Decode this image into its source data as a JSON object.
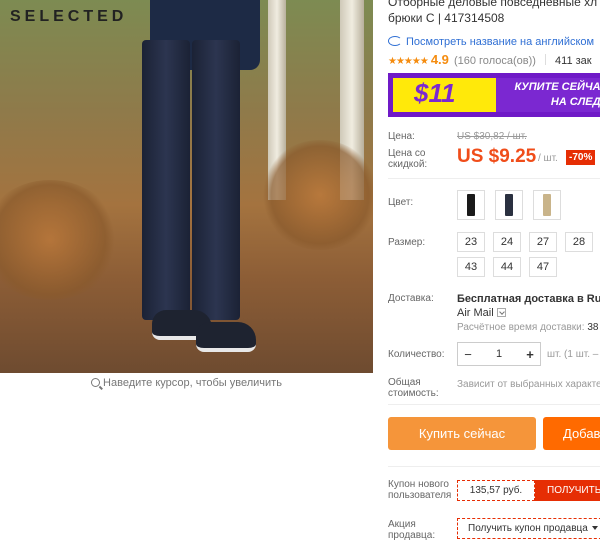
{
  "gallery": {
    "brand": "SELECTED",
    "zoom_hint": "Наведите курсор, чтобы увеличить"
  },
  "product": {
    "title_line1": "Отборные деловые повседневные хл",
    "title_line2": "брюки C | 417314508",
    "translate_link": "Посмотреть название на английском",
    "stars": "★★★★★",
    "rating": "4.9",
    "votes": "(160 голоса(ов))",
    "orders": "411 зак"
  },
  "promo": {
    "amount": "$11",
    "line1": "КУПИТЕ СЕЙЧАС",
    "line2": "НА СЛЕДУ"
  },
  "price": {
    "old_label": "Цена:",
    "old_value": "US $30,82 / шт.",
    "new_label_line1": "Цена со",
    "new_label_line2": "скидкой:",
    "new_value": "US $9.25",
    "unit": "/ шт.",
    "discount": "-70%"
  },
  "options": {
    "color_label": "Цвет:",
    "size_label": "Размер:",
    "sizes": [
      "23",
      "24",
      "27",
      "28",
      "43",
      "44",
      "47"
    ]
  },
  "shipping": {
    "label": "Доставка:",
    "text_line1": "Бесплатная доставка в Russia",
    "text_line2": "Air Mail",
    "time_label": "Расчётное время доставки:",
    "time_value": "38"
  },
  "quantity": {
    "label": "Количество:",
    "minus": "−",
    "value": "1",
    "plus": "+",
    "unit": "шт. (1 шт. – не"
  },
  "total": {
    "label_line1": "Общая",
    "label_line2": "стоимость:",
    "value": "Зависит от выбранных характе"
  },
  "actions": {
    "buy_now": "Купить сейчас",
    "add_to_cart": "Добав"
  },
  "coupon": {
    "label_line1": "Купон нового",
    "label_line2": "пользователя",
    "value": "135,57 руб.",
    "button": "ПОЛУЧИТЬ"
  },
  "seller": {
    "label_line1": "Акция",
    "label_line2": "продавца:",
    "select": "Получить купон продавца"
  },
  "colors": {
    "accent_price": "#f04d1a",
    "discount_bg": "#e62e04",
    "buy_now_bg": "#f5953a",
    "add_cart_bg": "#ff6a00",
    "promo_purple": "#6f1ac7",
    "promo_yellow": "#ffe90a",
    "link_blue": "#2f6fd4"
  }
}
